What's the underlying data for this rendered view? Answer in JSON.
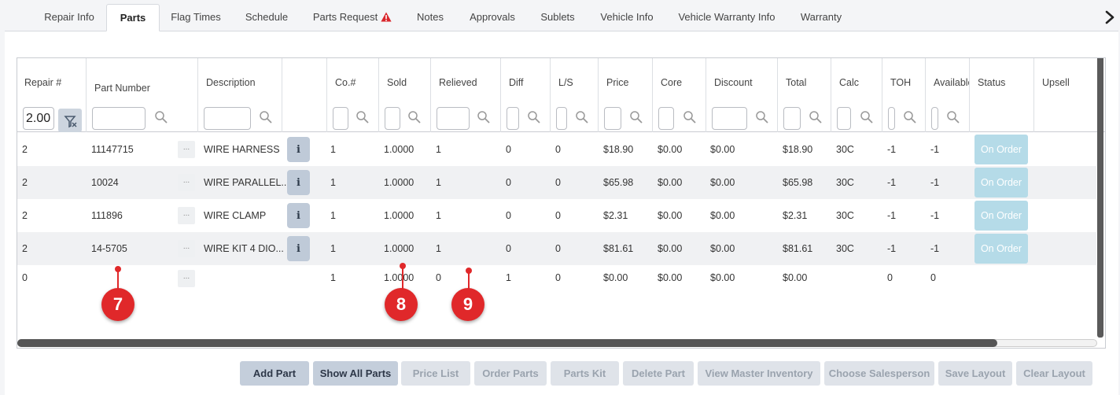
{
  "tabs": [
    {
      "label": "Repair Info"
    },
    {
      "label": "Parts"
    },
    {
      "label": "Flag Times"
    },
    {
      "label": "Schedule"
    },
    {
      "label": "Parts Request"
    },
    {
      "label": "Notes"
    },
    {
      "label": "Approvals"
    },
    {
      "label": "Sublets"
    },
    {
      "label": "Vehicle Info"
    },
    {
      "label": "Vehicle Warranty Info"
    },
    {
      "label": "Warranty"
    }
  ],
  "active_tab": "Parts",
  "grid": {
    "columns": {
      "repair": "Repair #",
      "part_number": "Part Number",
      "description": "Description",
      "co": "Co.#",
      "sold": "Sold",
      "relieved": "Relieved",
      "diff": "Diff",
      "ls": "L/S",
      "price": "Price",
      "core": "Core",
      "discount": "Discount",
      "total": "Total",
      "calc": "Calc",
      "toh": "TOH",
      "available": "Available",
      "status": "Status",
      "upsell": "Upsell"
    },
    "repair_filter_value": "2.00",
    "rows": [
      {
        "repair": "2",
        "part": "11147715",
        "desc": "WIRE HARNESS",
        "co": "1",
        "sold": "1.0000",
        "relieved": "1",
        "diff": "0",
        "ls": "0",
        "price": "$18.90",
        "core": "$0.00",
        "discount": "$0.00",
        "total": "$18.90",
        "calc": "30C",
        "toh": "-1",
        "available": "-1",
        "status": "On Order"
      },
      {
        "repair": "2",
        "part": "10024",
        "desc": "WIRE PARALLEL...",
        "co": "1",
        "sold": "1.0000",
        "relieved": "1",
        "diff": "0",
        "ls": "0",
        "price": "$65.98",
        "core": "$0.00",
        "discount": "$0.00",
        "total": "$65.98",
        "calc": "30C",
        "toh": "-1",
        "available": "-1",
        "status": "On Order"
      },
      {
        "repair": "2",
        "part": "111896",
        "desc": "WIRE CLAMP",
        "co": "1",
        "sold": "1.0000",
        "relieved": "1",
        "diff": "0",
        "ls": "0",
        "price": "$2.31",
        "core": "$0.00",
        "discount": "$0.00",
        "total": "$2.31",
        "calc": "30C",
        "toh": "-1",
        "available": "-1",
        "status": "On Order"
      },
      {
        "repair": "2",
        "part": "14-5705",
        "desc": "WIRE KIT 4 DIO...",
        "co": "1",
        "sold": "1.0000",
        "relieved": "1",
        "diff": "0",
        "ls": "0",
        "price": "$81.61",
        "core": "$0.00",
        "discount": "$0.00",
        "total": "$81.61",
        "calc": "30C",
        "toh": "-1",
        "available": "-1",
        "status": "On Order"
      },
      {
        "repair": "0",
        "part": "",
        "desc": "",
        "co": "1",
        "sold": "1.0000",
        "relieved": "0",
        "diff": "1",
        "ls": "0",
        "price": "$0.00",
        "core": "$0.00",
        "discount": "$0.00",
        "total": "$0.00",
        "calc": "",
        "toh": "0",
        "available": "0",
        "status": ""
      }
    ],
    "info_glyph": "i",
    "ellipsis_glyph": "..."
  },
  "callouts": [
    "7",
    "8",
    "9"
  ],
  "buttons": [
    {
      "label": "Add Part",
      "enabled": true
    },
    {
      "label": "Show All Parts",
      "enabled": true
    },
    {
      "label": "Price List",
      "enabled": false
    },
    {
      "label": "Order Parts",
      "enabled": false
    },
    {
      "label": "Parts Kit",
      "enabled": false
    },
    {
      "label": "Delete Part",
      "enabled": false
    },
    {
      "label": "View Master Inventory",
      "enabled": false
    },
    {
      "label": "Choose Salesperson",
      "enabled": false
    },
    {
      "label": "Save Layout",
      "enabled": false
    },
    {
      "label": "Clear Layout",
      "enabled": false
    }
  ],
  "colors": {
    "status_on_order": "#b5dbe8",
    "callout": "#e0282a",
    "warning": "#d9262b"
  }
}
